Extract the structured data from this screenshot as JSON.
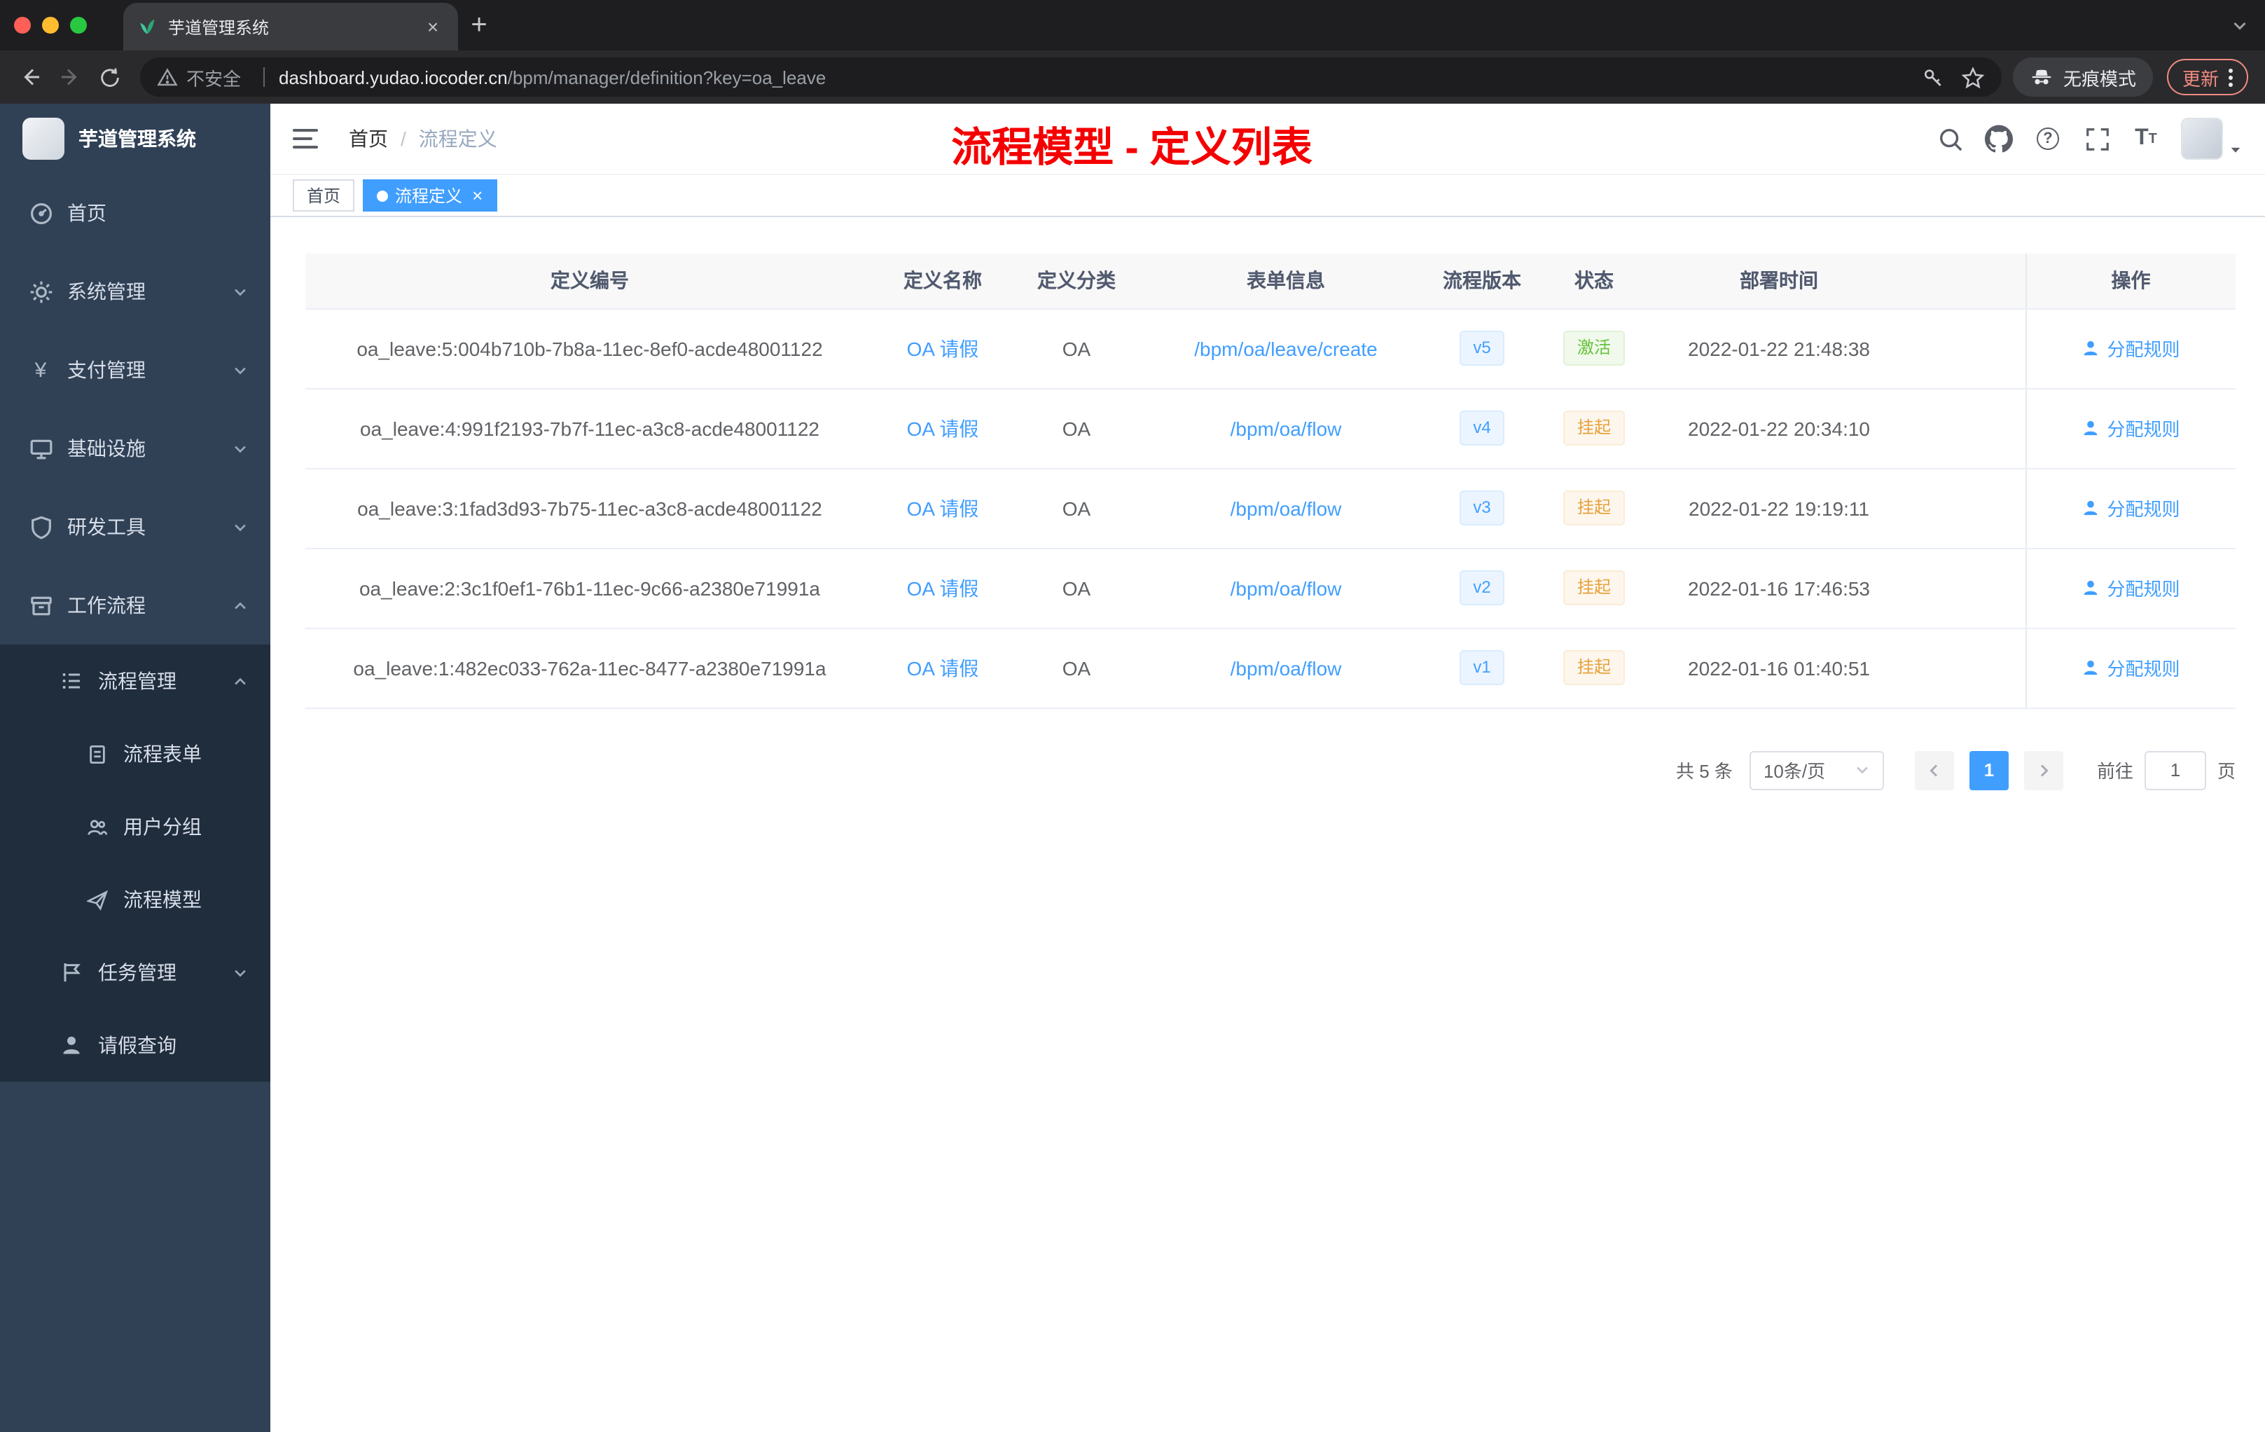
{
  "browser": {
    "tab_title": "芋道管理系统",
    "security_label": "不安全",
    "url_domain": "dashboard.yudao.iocoder.cn",
    "url_path": "/bpm/manager/definition?key=oa_leave",
    "incognito_label": "无痕模式",
    "update_label": "更新"
  },
  "sidebar": {
    "app_title": "芋道管理系统",
    "items": [
      {
        "label": "首页"
      },
      {
        "label": "系统管理"
      },
      {
        "label": "支付管理"
      },
      {
        "label": "基础设施"
      },
      {
        "label": "研发工具"
      },
      {
        "label": "工作流程"
      },
      {
        "label": "流程管理"
      },
      {
        "label": "流程表单"
      },
      {
        "label": "用户分组"
      },
      {
        "label": "流程模型"
      },
      {
        "label": "任务管理"
      },
      {
        "label": "请假查询"
      }
    ]
  },
  "navbar": {
    "breadcrumb_home": "首页",
    "breadcrumb_current": "流程定义",
    "overlay_title": "流程模型 - 定义列表"
  },
  "tags": {
    "home": "首页",
    "active": "流程定义"
  },
  "table": {
    "columns": [
      "定义编号",
      "定义名称",
      "定义分类",
      "表单信息",
      "流程版本",
      "状态",
      "部署时间",
      "操作"
    ],
    "rows": [
      {
        "id": "oa_leave:5:004b710b-7b8a-11ec-8ef0-acde48001122",
        "name": "OA 请假",
        "category": "OA",
        "form": "/bpm/oa/leave/create",
        "version": "v5",
        "status": "激活",
        "time": "2022-01-22 21:48:38",
        "action": "分配规则"
      },
      {
        "id": "oa_leave:4:991f2193-7b7f-11ec-a3c8-acde48001122",
        "name": "OA 请假",
        "category": "OA",
        "form": "/bpm/oa/flow",
        "version": "v4",
        "status": "挂起",
        "time": "2022-01-22 20:34:10",
        "action": "分配规则"
      },
      {
        "id": "oa_leave:3:1fad3d93-7b75-11ec-a3c8-acde48001122",
        "name": "OA 请假",
        "category": "OA",
        "form": "/bpm/oa/flow",
        "version": "v3",
        "status": "挂起",
        "time": "2022-01-22 19:19:11",
        "action": "分配规则"
      },
      {
        "id": "oa_leave:2:3c1f0ef1-76b1-11ec-9c66-a2380e71991a",
        "name": "OA 请假",
        "category": "OA",
        "form": "/bpm/oa/flow",
        "version": "v2",
        "status": "挂起",
        "time": "2022-01-16 17:46:53",
        "action": "分配规则"
      },
      {
        "id": "oa_leave:1:482ec033-762a-11ec-8477-a2380e71991a",
        "name": "OA 请假",
        "category": "OA",
        "form": "/bpm/oa/flow",
        "version": "v1",
        "status": "挂起",
        "time": "2022-01-16 01:40:51",
        "action": "分配规则"
      }
    ]
  },
  "pagination": {
    "total": "共 5 条",
    "page_size": "10条/页",
    "current_page": "1",
    "goto_label": "前往",
    "goto_value": "1",
    "unit_label": "页"
  },
  "colors": {
    "accent": "#409eff",
    "title_red": "#f50000",
    "status_active": "#67c23a",
    "status_suspend": "#e6a23c",
    "sidebar_bg": "#304156",
    "submenu_bg": "#1f2d3d"
  }
}
